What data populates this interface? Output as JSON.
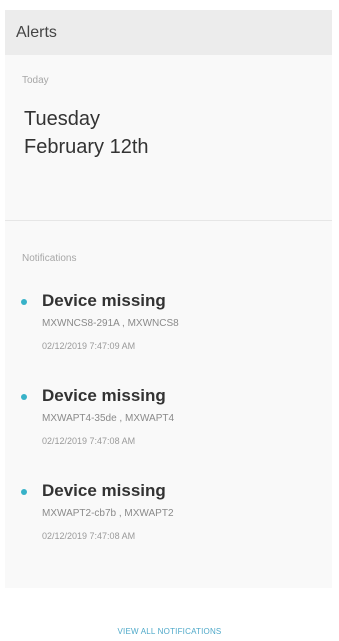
{
  "header": {
    "title": "Alerts"
  },
  "today": {
    "label": "Today",
    "day": "Tuesday",
    "date": "February 12th"
  },
  "notifications": {
    "label": "Notifications",
    "items": [
      {
        "title": "Device missing",
        "devices": "MXWNCS8-291A , MXWNCS8",
        "timestamp": "02/12/2019 7:47:09 AM"
      },
      {
        "title": "Device missing",
        "devices": "MXWAPT4-35de , MXWAPT4",
        "timestamp": "02/12/2019 7:47:08 AM"
      },
      {
        "title": "Device missing",
        "devices": "MXWAPT2-cb7b , MXWAPT2",
        "timestamp": "02/12/2019 7:47:08 AM"
      }
    ],
    "dot_color": "#38b2c8"
  },
  "footer": {
    "view_all_label": "VIEW ALL NOTIFICATIONS"
  },
  "colors": {
    "accent": "#4fa9c9",
    "header_bg": "#ececec",
    "panel_bg": "#f9f9f9"
  }
}
